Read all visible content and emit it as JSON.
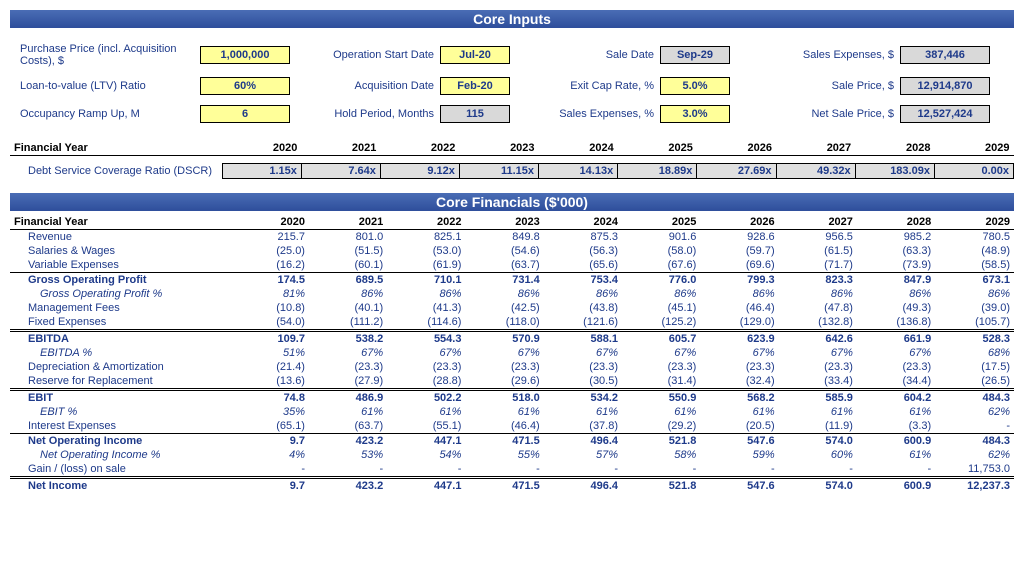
{
  "headers": {
    "inputs": "Core Inputs",
    "financials": "Core Financials ($'000)"
  },
  "inputs": {
    "purchase_price_lbl": "Purchase Price (incl. Acquisition Costs), $",
    "purchase_price": "1,000,000",
    "op_start_lbl": "Operation Start Date",
    "op_start": "Jul-20",
    "sale_date_lbl": "Sale Date",
    "sale_date": "Sep-29",
    "sales_exp_amt_lbl": "Sales Expenses, $",
    "sales_exp_amt": "387,446",
    "ltv_lbl": "Loan-to-value (LTV) Ratio",
    "ltv": "60%",
    "acq_date_lbl": "Acquisition Date",
    "acq_date": "Feb-20",
    "exit_cap_lbl": "Exit Cap Rate, %",
    "exit_cap": "5.0%",
    "sale_price_lbl": "Sale Price, $",
    "sale_price": "12,914,870",
    "ramp_lbl": "Occupancy Ramp Up, M",
    "ramp": "6",
    "hold_lbl": "Hold Period, Months",
    "hold": "115",
    "sales_exp_pct_lbl": "Sales Expenses, %",
    "sales_exp_pct": "3.0%",
    "net_sale_price_lbl": "Net Sale Price, $",
    "net_sale_price": "12,527,424"
  },
  "fy_label": "Financial Year",
  "years": [
    "2020",
    "2021",
    "2022",
    "2023",
    "2024",
    "2025",
    "2026",
    "2027",
    "2028",
    "2029"
  ],
  "dscr": {
    "label": "Debt Service Coverage Ratio (DSCR)",
    "values": [
      "1.15x",
      "7.64x",
      "9.12x",
      "11.15x",
      "14.13x",
      "18.89x",
      "27.69x",
      "49.32x",
      "183.09x",
      "0.00x"
    ]
  },
  "fin": {
    "revenue": {
      "label": "Revenue",
      "v": [
        "215.7",
        "801.0",
        "825.1",
        "849.8",
        "875.3",
        "901.6",
        "928.6",
        "956.5",
        "985.2",
        "780.5"
      ]
    },
    "salaries": {
      "label": "Salaries & Wages",
      "v": [
        "(25.0)",
        "(51.5)",
        "(53.0)",
        "(54.6)",
        "(56.3)",
        "(58.0)",
        "(59.7)",
        "(61.5)",
        "(63.3)",
        "(48.9)"
      ]
    },
    "var_exp": {
      "label": "Variable Expenses",
      "v": [
        "(16.2)",
        "(60.1)",
        "(61.9)",
        "(63.7)",
        "(65.6)",
        "(67.6)",
        "(69.6)",
        "(71.7)",
        "(73.9)",
        "(58.5)"
      ]
    },
    "gop": {
      "label": "Gross Operating Profit",
      "v": [
        "174.5",
        "689.5",
        "710.1",
        "731.4",
        "753.4",
        "776.0",
        "799.3",
        "823.3",
        "847.9",
        "673.1"
      ]
    },
    "gop_pct": {
      "label": "Gross Operating Profit %",
      "v": [
        "81%",
        "86%",
        "86%",
        "86%",
        "86%",
        "86%",
        "86%",
        "86%",
        "86%",
        "86%"
      ]
    },
    "mgmt": {
      "label": "Management Fees",
      "v": [
        "(10.8)",
        "(40.1)",
        "(41.3)",
        "(42.5)",
        "(43.8)",
        "(45.1)",
        "(46.4)",
        "(47.8)",
        "(49.3)",
        "(39.0)"
      ]
    },
    "fixed": {
      "label": "Fixed Expenses",
      "v": [
        "(54.0)",
        "(111.2)",
        "(114.6)",
        "(118.0)",
        "(121.6)",
        "(125.2)",
        "(129.0)",
        "(132.8)",
        "(136.8)",
        "(105.7)"
      ]
    },
    "ebitda": {
      "label": "EBITDA",
      "v": [
        "109.7",
        "538.2",
        "554.3",
        "570.9",
        "588.1",
        "605.7",
        "623.9",
        "642.6",
        "661.9",
        "528.3"
      ]
    },
    "ebitda_pct": {
      "label": "EBITDA %",
      "v": [
        "51%",
        "67%",
        "67%",
        "67%",
        "67%",
        "67%",
        "67%",
        "67%",
        "67%",
        "68%"
      ]
    },
    "da": {
      "label": "Depreciation & Amortization",
      "v": [
        "(21.4)",
        "(23.3)",
        "(23.3)",
        "(23.3)",
        "(23.3)",
        "(23.3)",
        "(23.3)",
        "(23.3)",
        "(23.3)",
        "(17.5)"
      ]
    },
    "reserve": {
      "label": "Reserve for Replacement",
      "v": [
        "(13.6)",
        "(27.9)",
        "(28.8)",
        "(29.6)",
        "(30.5)",
        "(31.4)",
        "(32.4)",
        "(33.4)",
        "(34.4)",
        "(26.5)"
      ]
    },
    "ebit": {
      "label": "EBIT",
      "v": [
        "74.8",
        "486.9",
        "502.2",
        "518.0",
        "534.2",
        "550.9",
        "568.2",
        "585.9",
        "604.2",
        "484.3"
      ]
    },
    "ebit_pct": {
      "label": "EBIT %",
      "v": [
        "35%",
        "61%",
        "61%",
        "61%",
        "61%",
        "61%",
        "61%",
        "61%",
        "61%",
        "62%"
      ]
    },
    "interest": {
      "label": "Interest Expenses",
      "v": [
        "(65.1)",
        "(63.7)",
        "(55.1)",
        "(46.4)",
        "(37.8)",
        "(29.2)",
        "(20.5)",
        "(11.9)",
        "(3.3)",
        "-"
      ]
    },
    "noi": {
      "label": "Net Operating Income",
      "v": [
        "9.7",
        "423.2",
        "447.1",
        "471.5",
        "496.4",
        "521.8",
        "547.6",
        "574.0",
        "600.9",
        "484.3"
      ]
    },
    "noi_pct": {
      "label": "Net Operating Income %",
      "v": [
        "4%",
        "53%",
        "54%",
        "55%",
        "57%",
        "58%",
        "59%",
        "60%",
        "61%",
        "62%"
      ]
    },
    "gain": {
      "label": "Gain / (loss) on sale",
      "v": [
        "-",
        "-",
        "-",
        "-",
        "-",
        "-",
        "-",
        "-",
        "-",
        "11,753.0"
      ]
    },
    "net_income": {
      "label": "Net Income",
      "v": [
        "9.7",
        "423.2",
        "447.1",
        "471.5",
        "496.4",
        "521.8",
        "547.6",
        "574.0",
        "600.9",
        "12,237.3"
      ]
    }
  }
}
